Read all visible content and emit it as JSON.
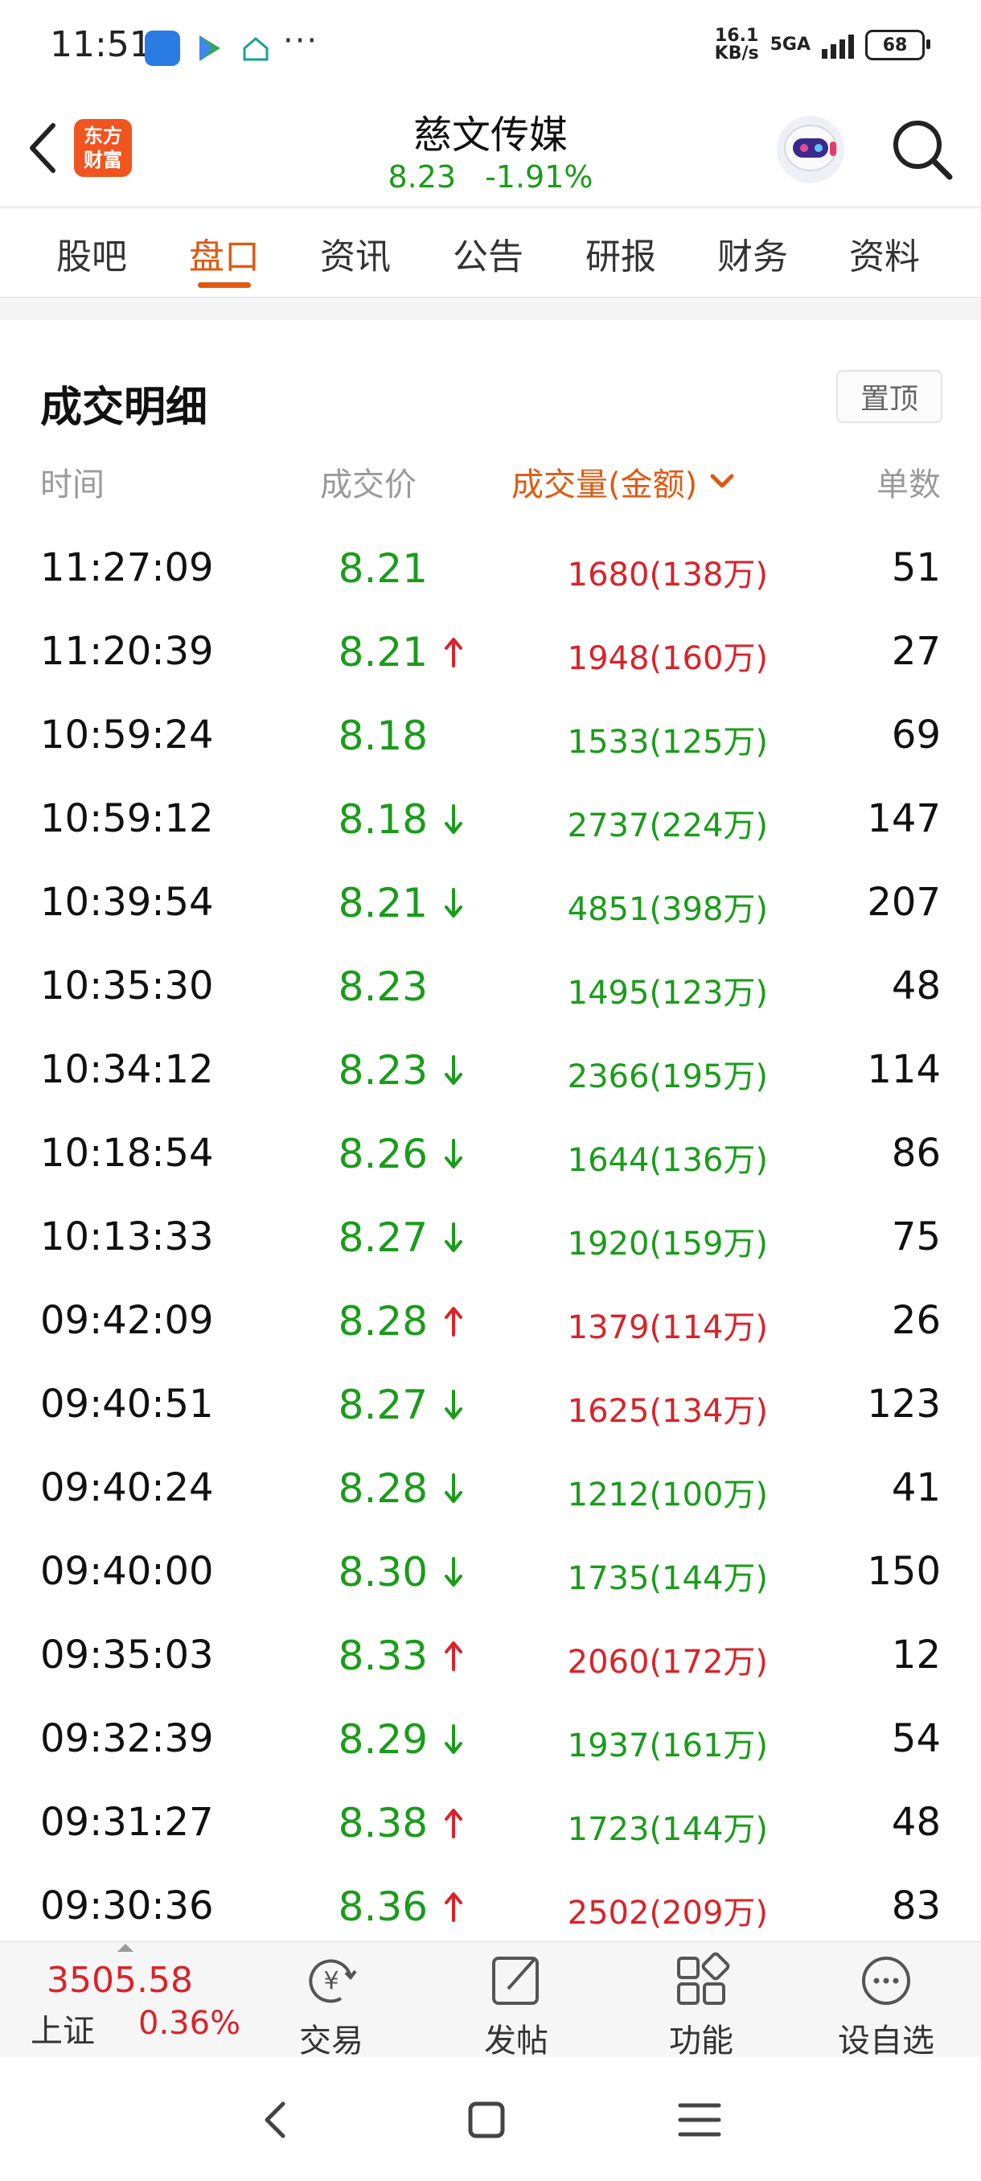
{
  "status_bar": {
    "time": "11:51",
    "dots": "···",
    "speed_value": "16.1",
    "speed_unit": "KB/s",
    "network": "5GA",
    "battery": "68"
  },
  "header": {
    "logo_line1": "东方",
    "logo_line2": "财富",
    "stock_name": "慈文传媒",
    "price": "8.23",
    "change_pct": "-1.91%"
  },
  "tabs": [
    {
      "label": "股吧",
      "active": false
    },
    {
      "label": "盘口",
      "active": true
    },
    {
      "label": "资讯",
      "active": false
    },
    {
      "label": "公告",
      "active": false
    },
    {
      "label": "研报",
      "active": false
    },
    {
      "label": "财务",
      "active": false
    },
    {
      "label": "资料",
      "active": false
    }
  ],
  "section": {
    "title": "成交明细",
    "pin_label": "置顶",
    "columns": {
      "time": "时间",
      "price": "成交价",
      "volume": "成交量(金额)",
      "count": "单数"
    }
  },
  "trades": [
    {
      "time": "11:27:09",
      "price": "8.21",
      "arrow": "none",
      "volume": "1680(138万)",
      "side": "buy",
      "count": "51"
    },
    {
      "time": "11:20:39",
      "price": "8.21",
      "arrow": "up",
      "volume": "1948(160万)",
      "side": "buy",
      "count": "27"
    },
    {
      "time": "10:59:24",
      "price": "8.18",
      "arrow": "none",
      "volume": "1533(125万)",
      "side": "sell",
      "count": "69"
    },
    {
      "time": "10:59:12",
      "price": "8.18",
      "arrow": "down",
      "volume": "2737(224万)",
      "side": "sell",
      "count": "147"
    },
    {
      "time": "10:39:54",
      "price": "8.21",
      "arrow": "down",
      "volume": "4851(398万)",
      "side": "sell",
      "count": "207"
    },
    {
      "time": "10:35:30",
      "price": "8.23",
      "arrow": "none",
      "volume": "1495(123万)",
      "side": "sell",
      "count": "48"
    },
    {
      "time": "10:34:12",
      "price": "8.23",
      "arrow": "down",
      "volume": "2366(195万)",
      "side": "sell",
      "count": "114"
    },
    {
      "time": "10:18:54",
      "price": "8.26",
      "arrow": "down",
      "volume": "1644(136万)",
      "side": "sell",
      "count": "86"
    },
    {
      "time": "10:13:33",
      "price": "8.27",
      "arrow": "down",
      "volume": "1920(159万)",
      "side": "sell",
      "count": "75"
    },
    {
      "time": "09:42:09",
      "price": "8.28",
      "arrow": "up",
      "volume": "1379(114万)",
      "side": "buy",
      "count": "26"
    },
    {
      "time": "09:40:51",
      "price": "8.27",
      "arrow": "down",
      "volume": "1625(134万)",
      "side": "buy",
      "count": "123"
    },
    {
      "time": "09:40:24",
      "price": "8.28",
      "arrow": "down",
      "volume": "1212(100万)",
      "side": "sell",
      "count": "41"
    },
    {
      "time": "09:40:00",
      "price": "8.30",
      "arrow": "down",
      "volume": "1735(144万)",
      "side": "sell",
      "count": "150"
    },
    {
      "time": "09:35:03",
      "price": "8.33",
      "arrow": "up",
      "volume": "2060(172万)",
      "side": "buy",
      "count": "12"
    },
    {
      "time": "09:32:39",
      "price": "8.29",
      "arrow": "down",
      "volume": "1937(161万)",
      "side": "sell",
      "count": "54"
    },
    {
      "time": "09:31:27",
      "price": "8.38",
      "arrow": "up",
      "volume": "1723(144万)",
      "side": "sell",
      "count": "48"
    },
    {
      "time": "09:30:36",
      "price": "8.36",
      "arrow": "up",
      "volume": "2502(209万)",
      "side": "buy",
      "count": "83"
    }
  ],
  "bottom_bar": {
    "index_value": "3505.58",
    "index_name": "上证",
    "index_pct": "0.36%",
    "items": [
      {
        "label": "交易",
        "icon": "trade-icon"
      },
      {
        "label": "发帖",
        "icon": "edit-icon"
      },
      {
        "label": "功能",
        "icon": "grid-icon"
      },
      {
        "label": "设自选",
        "icon": "more-icon"
      }
    ]
  },
  "colors": {
    "accent": "#e05a12",
    "up_red": "#d9232a",
    "down_green": "#1a9c1a"
  }
}
